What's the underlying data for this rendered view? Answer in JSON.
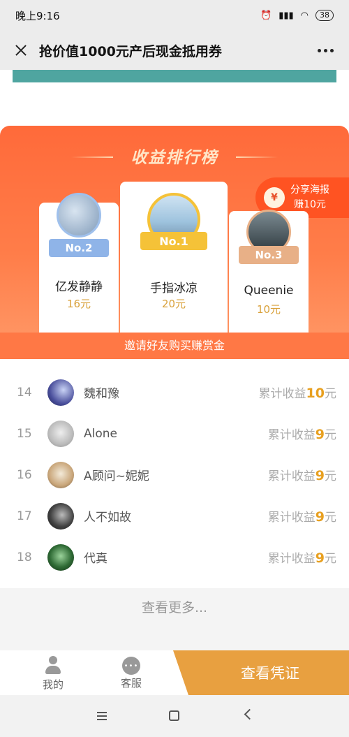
{
  "status_bar": {
    "time": "晚上9:16",
    "signal": "4G",
    "battery": "38"
  },
  "title_bar": {
    "title": "抢价值1000元产后现金抵用券"
  },
  "ranking": {
    "header": "收益排行榜",
    "share_badge": {
      "line1": "分享海报",
      "line2": "赚10元",
      "icon": "money-bag-icon"
    },
    "podium": [
      {
        "rank_label": "No.2",
        "name": "亿发静静",
        "earnings": "16元",
        "ribbon_color": "#8fb4e8"
      },
      {
        "rank_label": "No.1",
        "name": "手指冰凉",
        "earnings": "20元",
        "ribbon_color": "#f5c238"
      },
      {
        "rank_label": "No.3",
        "name": "Queenie",
        "earnings": "10元",
        "ribbon_color": "#e8b087"
      }
    ],
    "invite_text": "邀请好友购买赚赏金"
  },
  "list": {
    "earn_prefix": "累计收益",
    "earn_suffix": "元",
    "rows": [
      {
        "rank": "14",
        "name": "魏和豫",
        "amount": "10"
      },
      {
        "rank": "15",
        "name": "Alone",
        "amount": "9"
      },
      {
        "rank": "16",
        "name": "A顾问~妮妮",
        "amount": "9"
      },
      {
        "rank": "17",
        "name": "人不如故",
        "amount": "9"
      },
      {
        "rank": "18",
        "name": "代真",
        "amount": "9"
      }
    ]
  },
  "more_label": "查看更多...",
  "action_bar": {
    "tab_me": "我的",
    "tab_service": "客服",
    "primary_button": "查看凭证"
  },
  "colors": {
    "accent_orange": "#ff6a3a",
    "gold": "#e8a020",
    "voucher_button": "#e8a040",
    "teal": "#4fa5a0"
  }
}
